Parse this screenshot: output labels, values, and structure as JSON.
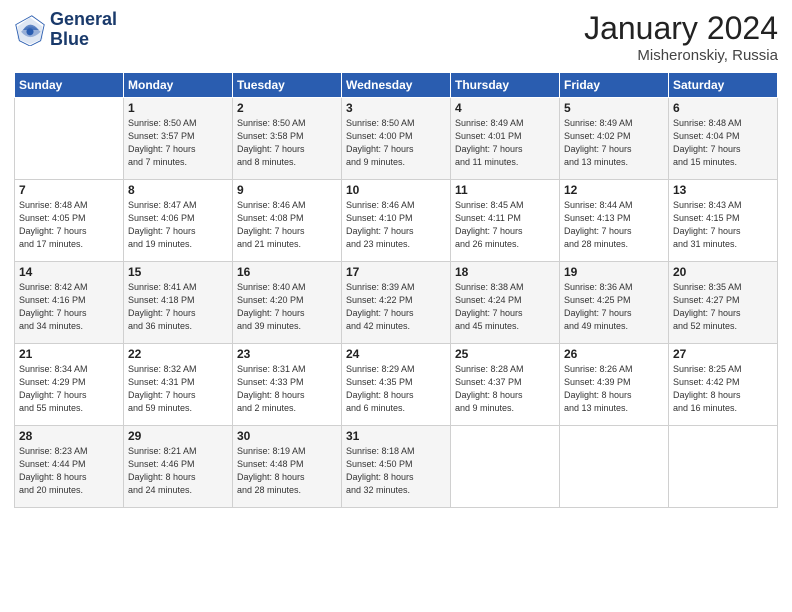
{
  "header": {
    "logo_text_general": "General",
    "logo_text_blue": "Blue",
    "title": "January 2024",
    "subtitle": "Misheronskiy, Russia"
  },
  "days_of_week": [
    "Sunday",
    "Monday",
    "Tuesday",
    "Wednesday",
    "Thursday",
    "Friday",
    "Saturday"
  ],
  "weeks": [
    [
      {
        "day": "",
        "info": ""
      },
      {
        "day": "1",
        "info": "Sunrise: 8:50 AM\nSunset: 3:57 PM\nDaylight: 7 hours\nand 7 minutes."
      },
      {
        "day": "2",
        "info": "Sunrise: 8:50 AM\nSunset: 3:58 PM\nDaylight: 7 hours\nand 8 minutes."
      },
      {
        "day": "3",
        "info": "Sunrise: 8:50 AM\nSunset: 4:00 PM\nDaylight: 7 hours\nand 9 minutes."
      },
      {
        "day": "4",
        "info": "Sunrise: 8:49 AM\nSunset: 4:01 PM\nDaylight: 7 hours\nand 11 minutes."
      },
      {
        "day": "5",
        "info": "Sunrise: 8:49 AM\nSunset: 4:02 PM\nDaylight: 7 hours\nand 13 minutes."
      },
      {
        "day": "6",
        "info": "Sunrise: 8:48 AM\nSunset: 4:04 PM\nDaylight: 7 hours\nand 15 minutes."
      }
    ],
    [
      {
        "day": "7",
        "info": "Sunrise: 8:48 AM\nSunset: 4:05 PM\nDaylight: 7 hours\nand 17 minutes."
      },
      {
        "day": "8",
        "info": "Sunrise: 8:47 AM\nSunset: 4:06 PM\nDaylight: 7 hours\nand 19 minutes."
      },
      {
        "day": "9",
        "info": "Sunrise: 8:46 AM\nSunset: 4:08 PM\nDaylight: 7 hours\nand 21 minutes."
      },
      {
        "day": "10",
        "info": "Sunrise: 8:46 AM\nSunset: 4:10 PM\nDaylight: 7 hours\nand 23 minutes."
      },
      {
        "day": "11",
        "info": "Sunrise: 8:45 AM\nSunset: 4:11 PM\nDaylight: 7 hours\nand 26 minutes."
      },
      {
        "day": "12",
        "info": "Sunrise: 8:44 AM\nSunset: 4:13 PM\nDaylight: 7 hours\nand 28 minutes."
      },
      {
        "day": "13",
        "info": "Sunrise: 8:43 AM\nSunset: 4:15 PM\nDaylight: 7 hours\nand 31 minutes."
      }
    ],
    [
      {
        "day": "14",
        "info": "Sunrise: 8:42 AM\nSunset: 4:16 PM\nDaylight: 7 hours\nand 34 minutes."
      },
      {
        "day": "15",
        "info": "Sunrise: 8:41 AM\nSunset: 4:18 PM\nDaylight: 7 hours\nand 36 minutes."
      },
      {
        "day": "16",
        "info": "Sunrise: 8:40 AM\nSunset: 4:20 PM\nDaylight: 7 hours\nand 39 minutes."
      },
      {
        "day": "17",
        "info": "Sunrise: 8:39 AM\nSunset: 4:22 PM\nDaylight: 7 hours\nand 42 minutes."
      },
      {
        "day": "18",
        "info": "Sunrise: 8:38 AM\nSunset: 4:24 PM\nDaylight: 7 hours\nand 45 minutes."
      },
      {
        "day": "19",
        "info": "Sunrise: 8:36 AM\nSunset: 4:25 PM\nDaylight: 7 hours\nand 49 minutes."
      },
      {
        "day": "20",
        "info": "Sunrise: 8:35 AM\nSunset: 4:27 PM\nDaylight: 7 hours\nand 52 minutes."
      }
    ],
    [
      {
        "day": "21",
        "info": "Sunrise: 8:34 AM\nSunset: 4:29 PM\nDaylight: 7 hours\nand 55 minutes."
      },
      {
        "day": "22",
        "info": "Sunrise: 8:32 AM\nSunset: 4:31 PM\nDaylight: 7 hours\nand 59 minutes."
      },
      {
        "day": "23",
        "info": "Sunrise: 8:31 AM\nSunset: 4:33 PM\nDaylight: 8 hours\nand 2 minutes."
      },
      {
        "day": "24",
        "info": "Sunrise: 8:29 AM\nSunset: 4:35 PM\nDaylight: 8 hours\nand 6 minutes."
      },
      {
        "day": "25",
        "info": "Sunrise: 8:28 AM\nSunset: 4:37 PM\nDaylight: 8 hours\nand 9 minutes."
      },
      {
        "day": "26",
        "info": "Sunrise: 8:26 AM\nSunset: 4:39 PM\nDaylight: 8 hours\nand 13 minutes."
      },
      {
        "day": "27",
        "info": "Sunrise: 8:25 AM\nSunset: 4:42 PM\nDaylight: 8 hours\nand 16 minutes."
      }
    ],
    [
      {
        "day": "28",
        "info": "Sunrise: 8:23 AM\nSunset: 4:44 PM\nDaylight: 8 hours\nand 20 minutes."
      },
      {
        "day": "29",
        "info": "Sunrise: 8:21 AM\nSunset: 4:46 PM\nDaylight: 8 hours\nand 24 minutes."
      },
      {
        "day": "30",
        "info": "Sunrise: 8:19 AM\nSunset: 4:48 PM\nDaylight: 8 hours\nand 28 minutes."
      },
      {
        "day": "31",
        "info": "Sunrise: 8:18 AM\nSunset: 4:50 PM\nDaylight: 8 hours\nand 32 minutes."
      },
      {
        "day": "",
        "info": ""
      },
      {
        "day": "",
        "info": ""
      },
      {
        "day": "",
        "info": ""
      }
    ]
  ]
}
